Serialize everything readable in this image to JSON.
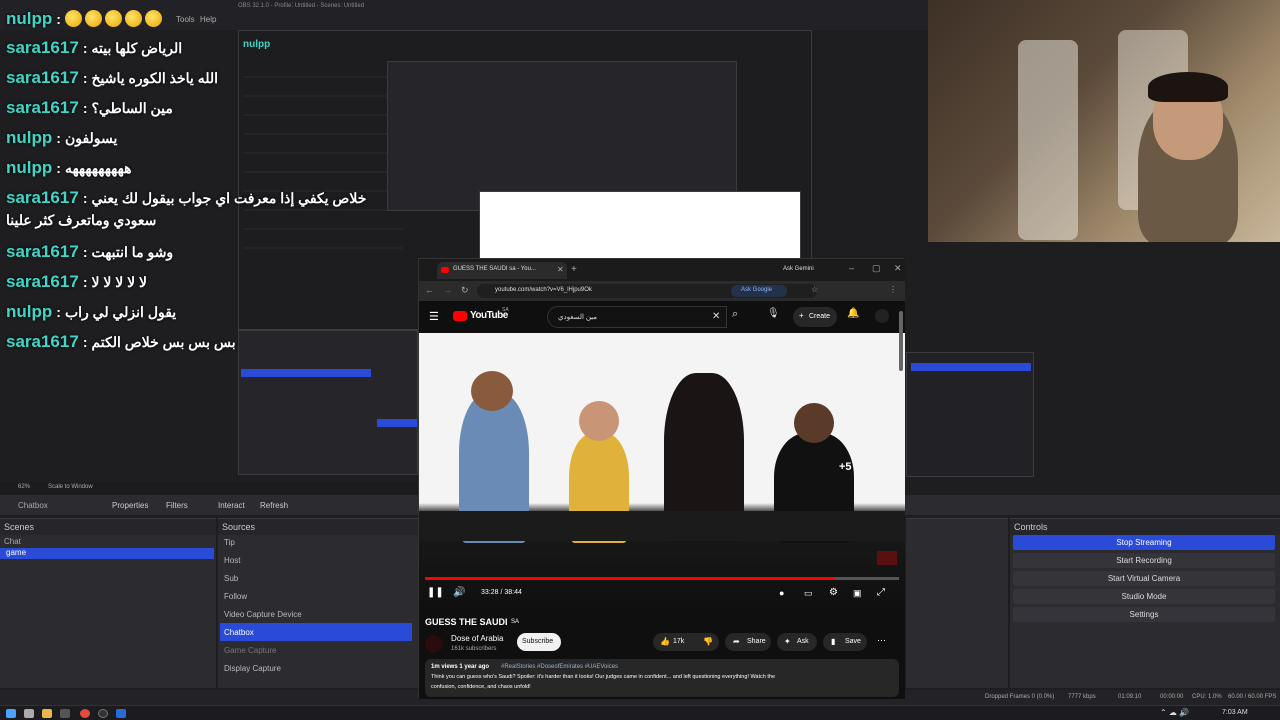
{
  "obs": {
    "title": "OBS 32.1.0 - Profile: Untitled - Scenes: Untitled",
    "menu": [
      "Tools",
      "Help"
    ],
    "scene_label": "Chatbox",
    "toolbar": {
      "properties": "Properties",
      "filters": "Filters",
      "interact": "Interact",
      "refresh": "Refresh"
    },
    "zoom": "62%",
    "scale": "Scale to Window",
    "scenes_title": "Scenes",
    "scenes": [
      "Chat",
      "game"
    ],
    "sources_title": "Sources",
    "sources": [
      "Tip",
      "Host",
      "Sub",
      "Follow",
      "Video Capture Device",
      "Chatbox",
      "Game Capture",
      "Display Capture"
    ],
    "controls_title": "Controls",
    "controls": [
      "Stop Streaming",
      "Start Recording",
      "Start Virtual Camera",
      "Studio Mode",
      "Settings"
    ],
    "status": {
      "dropped": "Dropped Frames 0 (0.0%)",
      "kbps": "7777 kbps",
      "stream_time": "01:09:10",
      "rec_time": "00:00:00",
      "cpu": "CPU: 1.0%",
      "fps": "60.00 / 60.00 FPS"
    }
  },
  "chat": [
    {
      "user": "nulpp",
      "msg": "",
      "emojis": 5
    },
    {
      "user": "sara1617",
      "msg": "الرياض كلها بيته"
    },
    {
      "user": "sara1617",
      "msg": "الله ياخذ الكوره ياشيخ"
    },
    {
      "user": "sara1617",
      "msg": "مين الساطي؟"
    },
    {
      "user": "nulpp",
      "msg": "يسولفون"
    },
    {
      "user": "nulpp",
      "msg": "هههههههههه"
    },
    {
      "user": "sara1617",
      "msg": "خلاص يكفي إذا معرفت اي جواب بيقول لك يعني"
    },
    {
      "user": "",
      "msg": "سعودي وماتعرف كثر علينا"
    },
    {
      "user": "sara1617",
      "msg": "وشو ما انتبهت"
    },
    {
      "user": "sara1617",
      "msg": "لا لا لا لا لا"
    },
    {
      "user": "nulpp",
      "msg": "يقول انزلي لي راب"
    },
    {
      "user": "sara1617",
      "msg": "بس بس بس خلاص الكتم"
    }
  ],
  "browser": {
    "tab_title": "GUESS THE SAUDI sa - You...",
    "ask_gemini": "Ask Gemini",
    "url": "youtube.com/watch?v=V6_lHjpu9Ok",
    "ask_google": "Ask Google",
    "yt_logo": "YouTube",
    "yt_region": "SA",
    "search_value": "مين السعودي",
    "create": "Create",
    "time": "33:28 / 38:44",
    "progress": 0.864,
    "video_title": "GUESS THE SAUDI",
    "video_title_flag": "SA",
    "channel": "Dose of Arabia",
    "subs": "161k subscribers",
    "subscribe": "Subscribe",
    "likes": "17k",
    "share": "Share",
    "ask": "Ask",
    "save": "Save",
    "views": "1m views  1 year ago",
    "tags": "#RealStories #DoseofEmirates #UAEVoices",
    "desc1": "Think you can guess who's Saudi? Spoiler: it's harder than it looks! Our judges came in confident... and left questioning everything! Watch the",
    "desc2": "confusion, confidence, and chaos unfold!",
    "video_badge": "+5"
  },
  "taskbar": {
    "time": "7:03 AM"
  },
  "colors": {
    "user": "#3fd6c6",
    "accent": "#2a4bd7",
    "yt_red": "#ff0000"
  }
}
